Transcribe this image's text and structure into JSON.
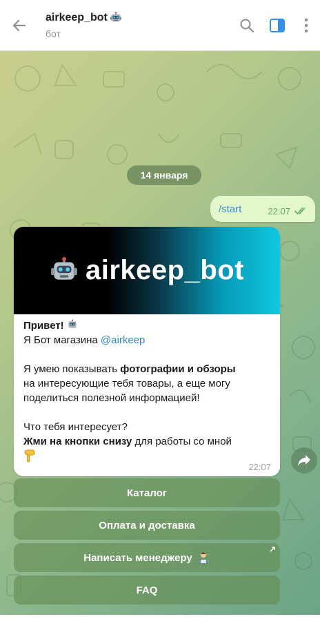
{
  "header": {
    "title": "airkeep_bot",
    "subtitle": "бот",
    "icons": [
      "back-arrow-icon",
      "bot-emoji-icon",
      "search-icon",
      "sidebar-toggle-icon",
      "more-vertical-icon"
    ]
  },
  "chat": {
    "date_label": "14 января",
    "outgoing": {
      "text": "/start",
      "time": "22:07",
      "status": "read"
    },
    "incoming": {
      "banner_text": "airkeep_bot",
      "greeting": "Привет!",
      "intro_prefix": "Я Бот магазина ",
      "intro_link": "@airkeep",
      "line2_prefix": "Я умею показывать ",
      "line2_bold": "фотографии и обзоры",
      "line3": "на интересующие тебя товары, а еще могу",
      "line4": "поделиться полезной информацией!",
      "line5": "Что тебя интересует?",
      "line6_bold": "Жми на кнопки снизу",
      "line6_rest": " для работы со мной",
      "time": "22:07"
    }
  },
  "keyboard": {
    "buttons": [
      "Каталог",
      "Оплата и доставка",
      "Написать менеджеру",
      "FAQ"
    ]
  },
  "colors": {
    "link": "#2f88c9",
    "outgoing_bubble": "#e2f7cb",
    "accent_blue": "#3390ec"
  }
}
